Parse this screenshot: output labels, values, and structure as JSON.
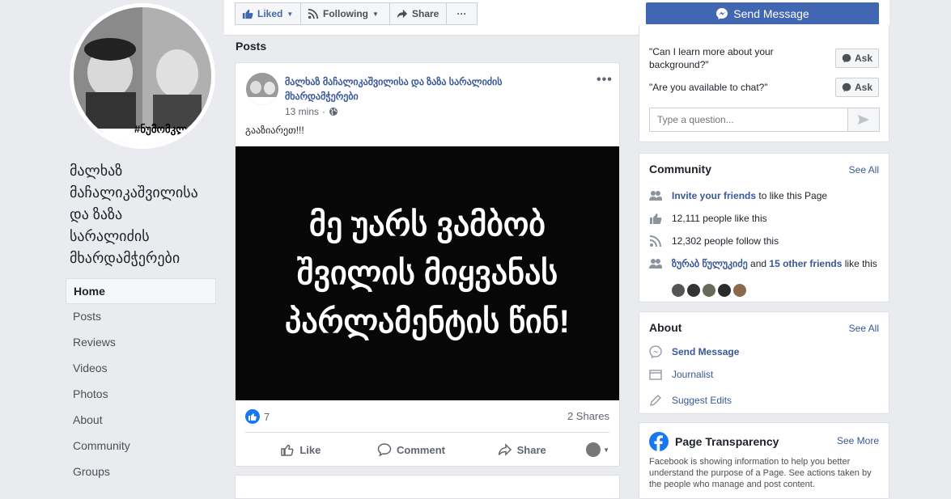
{
  "page": {
    "name_lines": [
      "მალხაზ",
      "მაჩალიკაშვილისა",
      "და ზაზა",
      "სარალიძის",
      "მხარდამჭერები"
    ],
    "profile_hashtag": "#ნუმომკლ"
  },
  "left_nav": [
    {
      "label": "Home",
      "active": true
    },
    {
      "label": "Posts"
    },
    {
      "label": "Reviews"
    },
    {
      "label": "Videos"
    },
    {
      "label": "Photos"
    },
    {
      "label": "About"
    },
    {
      "label": "Community"
    },
    {
      "label": "Groups"
    }
  ],
  "action_bar": {
    "liked": "Liked",
    "following": "Following",
    "share": "Share",
    "more": "···",
    "send_message": "Send Message"
  },
  "posts_section": {
    "title": "Posts",
    "post": {
      "author": "მალხაზ მაჩალიკაშვილისა და ზაზა სარალიძის მხარდამჭერები",
      "time": "13 mins",
      "privacy_icon": "globe-icon",
      "text": "გააზიარეთ!!!",
      "image_lines": [
        "მე უარს ვამბობ",
        "შვილის მიყვანას",
        "პარლამენტის წინ!"
      ],
      "reaction_count": "7",
      "shares": "2 Shares",
      "actions": {
        "like": "Like",
        "comment": "Comment",
        "share": "Share"
      }
    }
  },
  "questions": {
    "items": [
      {
        "text": "\"Can I learn more about your background?\"",
        "button": "Ask"
      },
      {
        "text": "\"Are you available to chat?\"",
        "button": "Ask"
      }
    ],
    "input_placeholder": "Type a question..."
  },
  "community": {
    "title": "Community",
    "see_all": "See All",
    "invite_link": "Invite your friends",
    "invite_rest": " to like this Page",
    "likes": "12,111 people like this",
    "follows": "12,302 people follow this",
    "friend_name": "ზურაბ წულუკიძე",
    "friend_and": " and ",
    "friend_others": "15 other friends",
    "friend_rest": " like this"
  },
  "about": {
    "title": "About",
    "see_all": "See All",
    "send_message": "Send Message",
    "category": "Journalist",
    "suggest": "Suggest Edits"
  },
  "transparency": {
    "title": "Page Transparency",
    "see_more": "See More",
    "text": "Facebook is showing information to help you better understand the purpose of a Page. See actions taken by the people who manage and post content."
  },
  "colors": {
    "brand": "#4267b2",
    "link": "#385898",
    "background": "#e9ebee"
  }
}
